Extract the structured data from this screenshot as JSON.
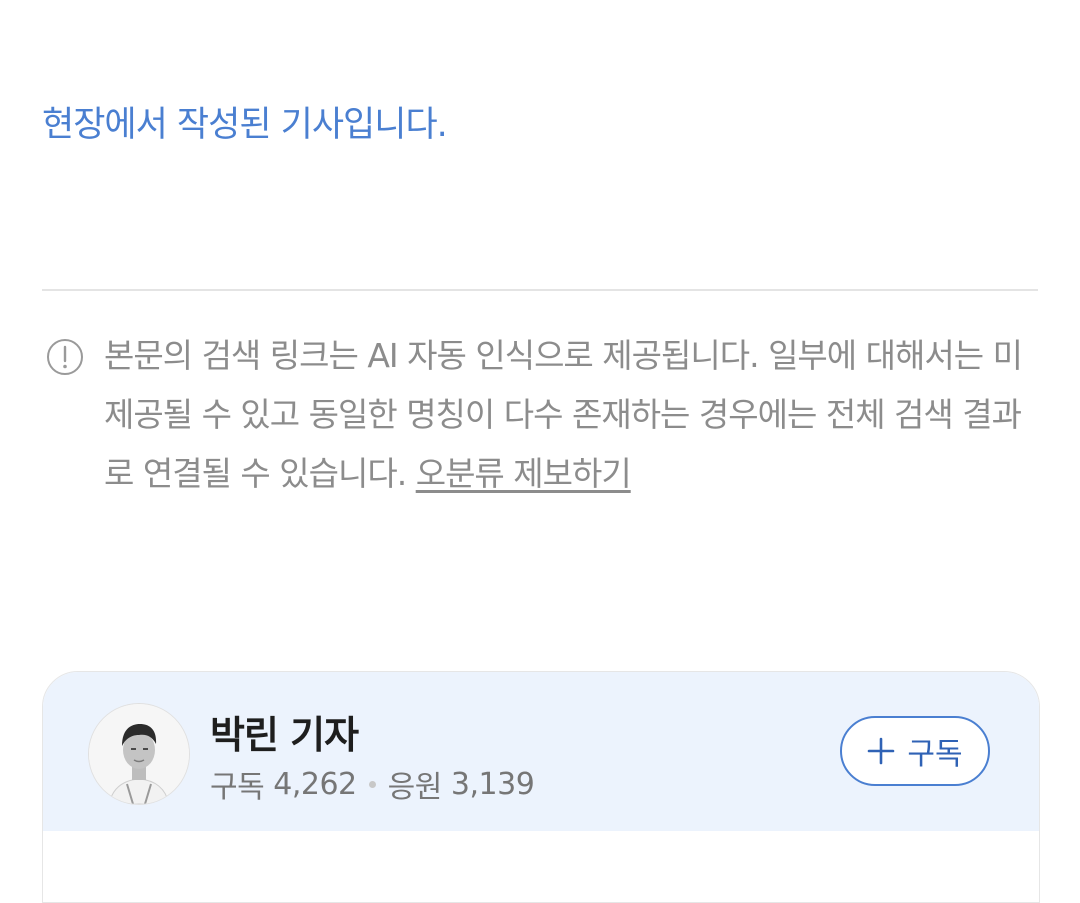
{
  "article": {
    "note": "현장에서 작성된 기사입니다."
  },
  "disclaimer": {
    "icon": "info-circle-icon",
    "text": "본문의 검색 링크는 AI 자동 인식으로 제공됩니다. 일부에 대해서는 미제공될 수 있고 동일한 명칭이 다수 존재하는 경우에는 전체 검색 결과로 연결될 수 있습니다.",
    "report_link": "오분류 제보하기"
  },
  "reporter": {
    "name": "박린 기자",
    "subscribers_label": "구독",
    "subscribers": "4,262",
    "cheers_label": "응원",
    "cheers": "3,139",
    "subscribe_button": "구독"
  },
  "colors": {
    "accent": "#4a7fd1",
    "card_bg": "#ecf3fd",
    "muted_text": "#8c8c8c"
  }
}
